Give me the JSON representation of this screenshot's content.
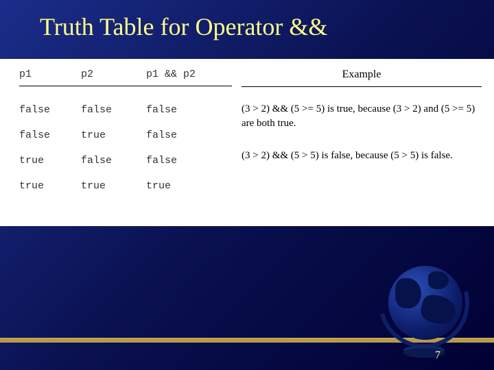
{
  "title": "Truth Table for Operator &&",
  "page_number": "7",
  "truth_table": {
    "headers": {
      "c1": "p1",
      "c2": "p2",
      "c3": "p1 && p2"
    },
    "rows": [
      {
        "c1": "false",
        "c2": "false",
        "c3": "false"
      },
      {
        "c1": "false",
        "c2": "true",
        "c3": "false"
      },
      {
        "c1": "true",
        "c2": "false",
        "c3": "false"
      },
      {
        "c1": "true",
        "c2": "true",
        "c3": "true"
      }
    ]
  },
  "examples": {
    "header": "Example",
    "items": [
      "(3 > 2) && (5 >= 5) is true, because (3 > 2) and (5 >= 5) are both true.",
      "(3 > 2) && (5 > 5) is false, because (5 > 5) is false."
    ]
  }
}
